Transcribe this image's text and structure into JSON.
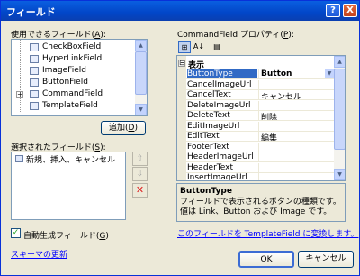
{
  "window": {
    "title": "フィールド",
    "help_glyph": "?",
    "close_glyph": "X"
  },
  "available": {
    "label_prefix": "使用できるフィールド(",
    "label_key": "A",
    "label_suffix": "):",
    "items": [
      {
        "text": "CheckBoxField",
        "icon": "checkbox-field-icon"
      },
      {
        "text": "HyperLinkField",
        "icon": "hyperlink-field-icon"
      },
      {
        "text": "ImageField",
        "icon": "image-field-icon"
      },
      {
        "text": "ButtonField",
        "icon": "button-field-icon"
      },
      {
        "text": "CommandField",
        "icon": "command-field-icon",
        "expander": "+"
      },
      {
        "text": "TemplateField",
        "icon": "template-field-icon"
      }
    ],
    "add_button_prefix": "追加(",
    "add_button_key": "D",
    "add_button_suffix": ")"
  },
  "selected": {
    "label_prefix": "選択されたフィールド(",
    "label_key": "S",
    "label_suffix": "):",
    "items": [
      {
        "text": "新規、挿入、キャンセル",
        "icon": "command-field-icon"
      }
    ],
    "up_glyph": "⇧",
    "down_glyph": "⇩",
    "delete_glyph": "✕"
  },
  "autogen": {
    "label_prefix": "自動生成フィールド(",
    "label_key": "G",
    "label_suffix": ")",
    "checked": true,
    "check_glyph": "✓"
  },
  "refresh_link": "スキーマの更新",
  "properties": {
    "label_prefix": "CommandField プロパティ(",
    "label_key": "P",
    "label_suffix": "):",
    "tool_categorized": "⊞",
    "tool_alpha": "A↓",
    "tool_pages": "▤",
    "category": "表示",
    "category_expander": "⊟",
    "dropdown_glyph": "▼",
    "rows": [
      {
        "name": "ButtonType",
        "value": "Button",
        "selected": true
      },
      {
        "name": "CancelImageUrl",
        "value": ""
      },
      {
        "name": "CancelText",
        "value": "キャンセル"
      },
      {
        "name": "DeleteImageUrl",
        "value": ""
      },
      {
        "name": "DeleteText",
        "value": "削除"
      },
      {
        "name": "EditImageUrl",
        "value": ""
      },
      {
        "name": "EditText",
        "value": "編集"
      },
      {
        "name": "FooterText",
        "value": ""
      },
      {
        "name": "HeaderImageUrl",
        "value": ""
      },
      {
        "name": "HeaderText",
        "value": ""
      },
      {
        "name": "InsertImageUrl",
        "value": ""
      }
    ],
    "description_title": "ButtonType",
    "description_text": "フィールドで表示されるボタンの種類です。値は Link、Button および Image です。"
  },
  "convert_link": "このフィールドを TemplateField に変換します。",
  "buttons": {
    "ok": "OK",
    "cancel": "キャンセル"
  },
  "scroll_glyphs": {
    "up": "▲",
    "down": "▼"
  }
}
